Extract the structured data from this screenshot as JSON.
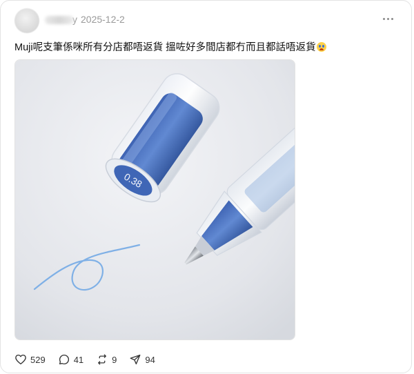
{
  "post": {
    "username_visible_suffix": "y",
    "date": "2025-12-2",
    "text": "Muji呢支筆係咪所有分店都唔返貨 搵咗好多間店都冇而且都話唔返貨",
    "emoji_icon": "crying-face-emoji",
    "image_icon": "muji-gel-pen-photo",
    "pen_cap_label": "0.38"
  },
  "actions": {
    "likes": "529",
    "comments": "41",
    "reposts": "9",
    "shares": "94"
  },
  "colors": {
    "text": "#111111",
    "meta": "#999999",
    "ink_blue": "#4d78c4",
    "scribble": "#7fb0e6"
  }
}
